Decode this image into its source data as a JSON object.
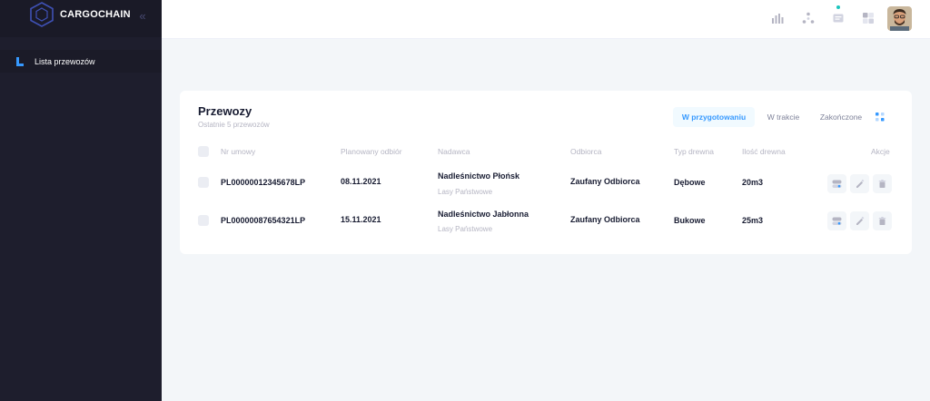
{
  "app": {
    "name": "CARGOCHAIN"
  },
  "sidebar": {
    "collapse_icon": "double-chevron-left-icon",
    "items": [
      {
        "label": "Lista przewozów",
        "icon": "list-icon"
      }
    ]
  },
  "header": {
    "icons": [
      "bar-chart-icon",
      "network-icon",
      "chat-icon",
      "grid-icon"
    ],
    "notification_dot_color": "#1bc5bd"
  },
  "card": {
    "title": "Przewozy",
    "subtitle": "Ostatnie 5 przewozów",
    "tabs": [
      {
        "label": "W przygotowaniu",
        "active": true
      },
      {
        "label": "W trakcie",
        "active": false
      },
      {
        "label": "Zakończone",
        "active": false
      }
    ],
    "columns": [
      "Nr umowy",
      "Planowany odbiór",
      "Nadawca",
      "Odbiorca",
      "Typ drewna",
      "Ilość drewna",
      "Akcje"
    ],
    "rows": [
      {
        "contract": "PL00000012345678LP",
        "pickup": "08.11.2021",
        "sender": "Nadleśnictwo Płońsk",
        "sender_sub": "Lasy Państwowe",
        "recipient": "Zaufany Odbiorca",
        "wood_type": "Dębowe",
        "amount": "20m3"
      },
      {
        "contract": "PL00000087654321LP",
        "pickup": "15.11.2021",
        "sender": "Nadleśnictwo Jabłonna",
        "sender_sub": "Lasy Państwowe",
        "recipient": "Zaufany Odbiorca",
        "wood_type": "Bukowe",
        "amount": "25m3"
      }
    ],
    "row_actions": [
      "toggle-icon",
      "pencil-icon",
      "trash-icon"
    ]
  },
  "colors": {
    "accent": "#3699ff",
    "sidebar_bg": "#1e1e2d",
    "page_bg": "#f3f6f9"
  }
}
